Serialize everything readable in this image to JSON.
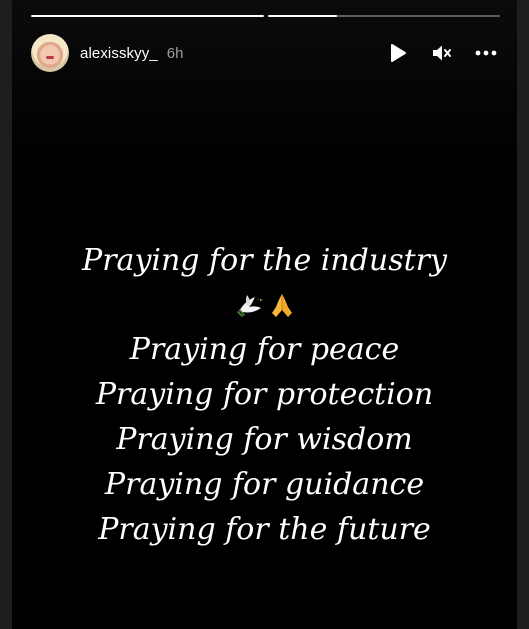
{
  "story": {
    "progress": [
      1.0,
      0.3
    ],
    "username": "alexisskyy_",
    "timestamp": "6h",
    "lines": {
      "l1": "Praying for the industry",
      "l2": "Praying for peace",
      "l3": "Praying for protection",
      "l4": "Praying for wisdom",
      "l5": "Praying for guidance",
      "l6": "Praying for the future"
    },
    "emojis": [
      "dove-icon",
      "praying-hands-icon"
    ]
  },
  "controls": {
    "play": "play-icon",
    "mute": "speaker-muted-icon",
    "more": "more-options-icon"
  }
}
